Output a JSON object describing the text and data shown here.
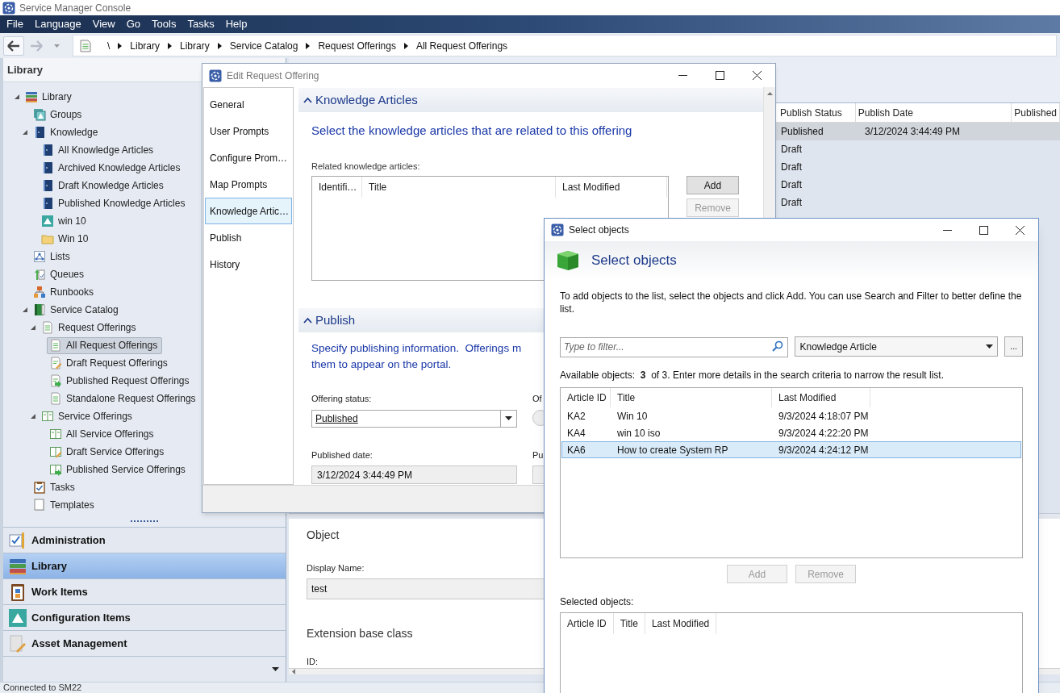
{
  "window": {
    "title": "Service Manager Console"
  },
  "menu": [
    "File",
    "Language",
    "View",
    "Go",
    "Tools",
    "Tasks",
    "Help"
  ],
  "breadcrumb": [
    "\\",
    "Library",
    "Library",
    "Service Catalog",
    "Request Offerings",
    "All Request Offerings"
  ],
  "navigation": {
    "title": "Library",
    "tree": [
      {
        "label": "Library",
        "kind": "books",
        "expanded": true,
        "selected": false,
        "children": [
          {
            "label": "Groups",
            "kind": "groups",
            "selected": false
          },
          {
            "label": "Knowledge",
            "kind": "book",
            "expanded": true,
            "selected": false,
            "children": [
              {
                "label": "All Knowledge Articles",
                "kind": "book",
                "selected": false
              },
              {
                "label": "Archived Knowledge Articles",
                "kind": "book",
                "selected": false
              },
              {
                "label": "Draft Knowledge Articles",
                "kind": "book",
                "selected": false
              },
              {
                "label": "Published Knowledge Articles",
                "kind": "book",
                "selected": false
              },
              {
                "label": "win 10",
                "kind": "ci",
                "selected": false
              },
              {
                "label": "Win 10",
                "kind": "folder",
                "selected": false
              }
            ]
          },
          {
            "label": "Lists",
            "kind": "lists",
            "selected": false
          },
          {
            "label": "Queues",
            "kind": "queues",
            "selected": false
          },
          {
            "label": "Runbooks",
            "kind": "runbooks",
            "selected": false
          },
          {
            "label": "Service Catalog",
            "kind": "catalog",
            "expanded": true,
            "selected": false,
            "children": [
              {
                "label": "Request Offerings",
                "kind": "doc",
                "expanded": true,
                "selected": false,
                "children": [
                  {
                    "label": "All Request Offerings",
                    "kind": "doc",
                    "selected": true
                  },
                  {
                    "label": "Draft Request Offerings",
                    "kind": "doc-draft",
                    "selected": false
                  },
                  {
                    "label": "Published Request Offerings",
                    "kind": "doc-publish",
                    "selected": false
                  },
                  {
                    "label": "Standalone Request Offerings",
                    "kind": "doc",
                    "selected": false
                  }
                ]
              },
              {
                "label": "Service Offerings",
                "kind": "service",
                "expanded": true,
                "selected": false,
                "children": [
                  {
                    "label": "All Service Offerings",
                    "kind": "service",
                    "selected": false
                  },
                  {
                    "label": "Draft Service Offerings",
                    "kind": "service-draft",
                    "selected": false
                  },
                  {
                    "label": "Published Service Offerings",
                    "kind": "service-publish",
                    "selected": false
                  }
                ]
              }
            ]
          },
          {
            "label": "Tasks",
            "kind": "tasks",
            "selected": false
          },
          {
            "label": "Templates",
            "kind": "templates",
            "selected": false
          }
        ]
      }
    ],
    "workspaces": [
      {
        "label": "Administration",
        "kind": "admin",
        "selected": false
      },
      {
        "label": "Library",
        "kind": "library",
        "selected": true
      },
      {
        "label": "Work Items",
        "kind": "work",
        "selected": false
      },
      {
        "label": "Configuration Items",
        "kind": "ci",
        "selected": false
      },
      {
        "label": "Asset Management",
        "kind": "asset",
        "selected": false
      }
    ]
  },
  "grid": {
    "columns": [
      "Publish Status",
      "Publish Date",
      "Published"
    ],
    "rows": [
      {
        "status": "Published",
        "date": "3/12/2024 3:44:49 PM",
        "selected": true
      },
      {
        "status": "Draft",
        "selected": false
      },
      {
        "status": "Draft",
        "selected": false
      },
      {
        "status": "Draft",
        "selected": false
      },
      {
        "status": "Draft",
        "selected": false
      }
    ]
  },
  "details": {
    "heading": "Object",
    "display_name_label": "Display Name:",
    "display_name": "test",
    "heading_2": "Extension base class",
    "id_label": "ID:"
  },
  "status_bar": "Connected to SM22",
  "edit_dialog": {
    "title": "Edit Request Offering",
    "nav": [
      {
        "label": "General",
        "selected": false
      },
      {
        "label": "User Prompts",
        "selected": false
      },
      {
        "label": "Configure Prom…",
        "selected": false
      },
      {
        "label": "Map Prompts",
        "selected": false
      },
      {
        "label": "Knowledge Artic…",
        "selected": true
      },
      {
        "label": "Publish",
        "selected": false
      },
      {
        "label": "History",
        "selected": false
      }
    ],
    "knowledge": {
      "heading": "Knowledge Articles",
      "expanded": true,
      "description": "Select the knowledge articles that are related to this offering",
      "list_label": "Related knowledge articles:",
      "columns": [
        "Identifi…",
        "Title",
        "Last Modified"
      ],
      "buttons": [
        {
          "label": "Add",
          "disabled": false
        },
        {
          "label": "Remove",
          "disabled": true
        }
      ]
    },
    "publish": {
      "heading": "Publish",
      "expanded": true,
      "description_lines": [
        "Specify publishing information.  Offerings m",
        "them to appear on the portal."
      ],
      "status_label": "Offering status:",
      "status": "Published",
      "label_2": "Of",
      "date_label": "Published date:",
      "date": "3/12/2024 3:44:49 PM",
      "label_3": "Pu"
    }
  },
  "select_dialog": {
    "title": "Select objects",
    "heading": "Select objects",
    "description": "To add objects to the list, select the objects and click Add. You can use Search and Filter to better define the list.",
    "filter_placeholder": "Type to filter...",
    "object_type": "Knowledge Article",
    "browse": "...",
    "available": "Available objects:  **3**  of 3. Enter more details in the search criteria to narrow the result list.",
    "columns": [
      "Article ID",
      "Title",
      "Last Modified"
    ],
    "rows": [
      {
        "id": "KA2",
        "title": "Win 10",
        "modified": "9/3/2024 4:18:07 PM",
        "selected": false
      },
      {
        "id": "KA4",
        "title": "win 10 iso",
        "modified": "9/3/2024 4:22:20 PM",
        "selected": false
      },
      {
        "id": "KA6",
        "title": "How to create System RP",
        "modified": "9/3/2024 4:24:12 PM",
        "selected": true
      }
    ],
    "buttons": [
      {
        "label": "Add",
        "disabled": true
      },
      {
        "label": "Remove",
        "disabled": true
      }
    ],
    "selected_label": "Selected objects:",
    "selected_columns": [
      "Article ID",
      "Title",
      "Last Modified"
    ]
  }
}
